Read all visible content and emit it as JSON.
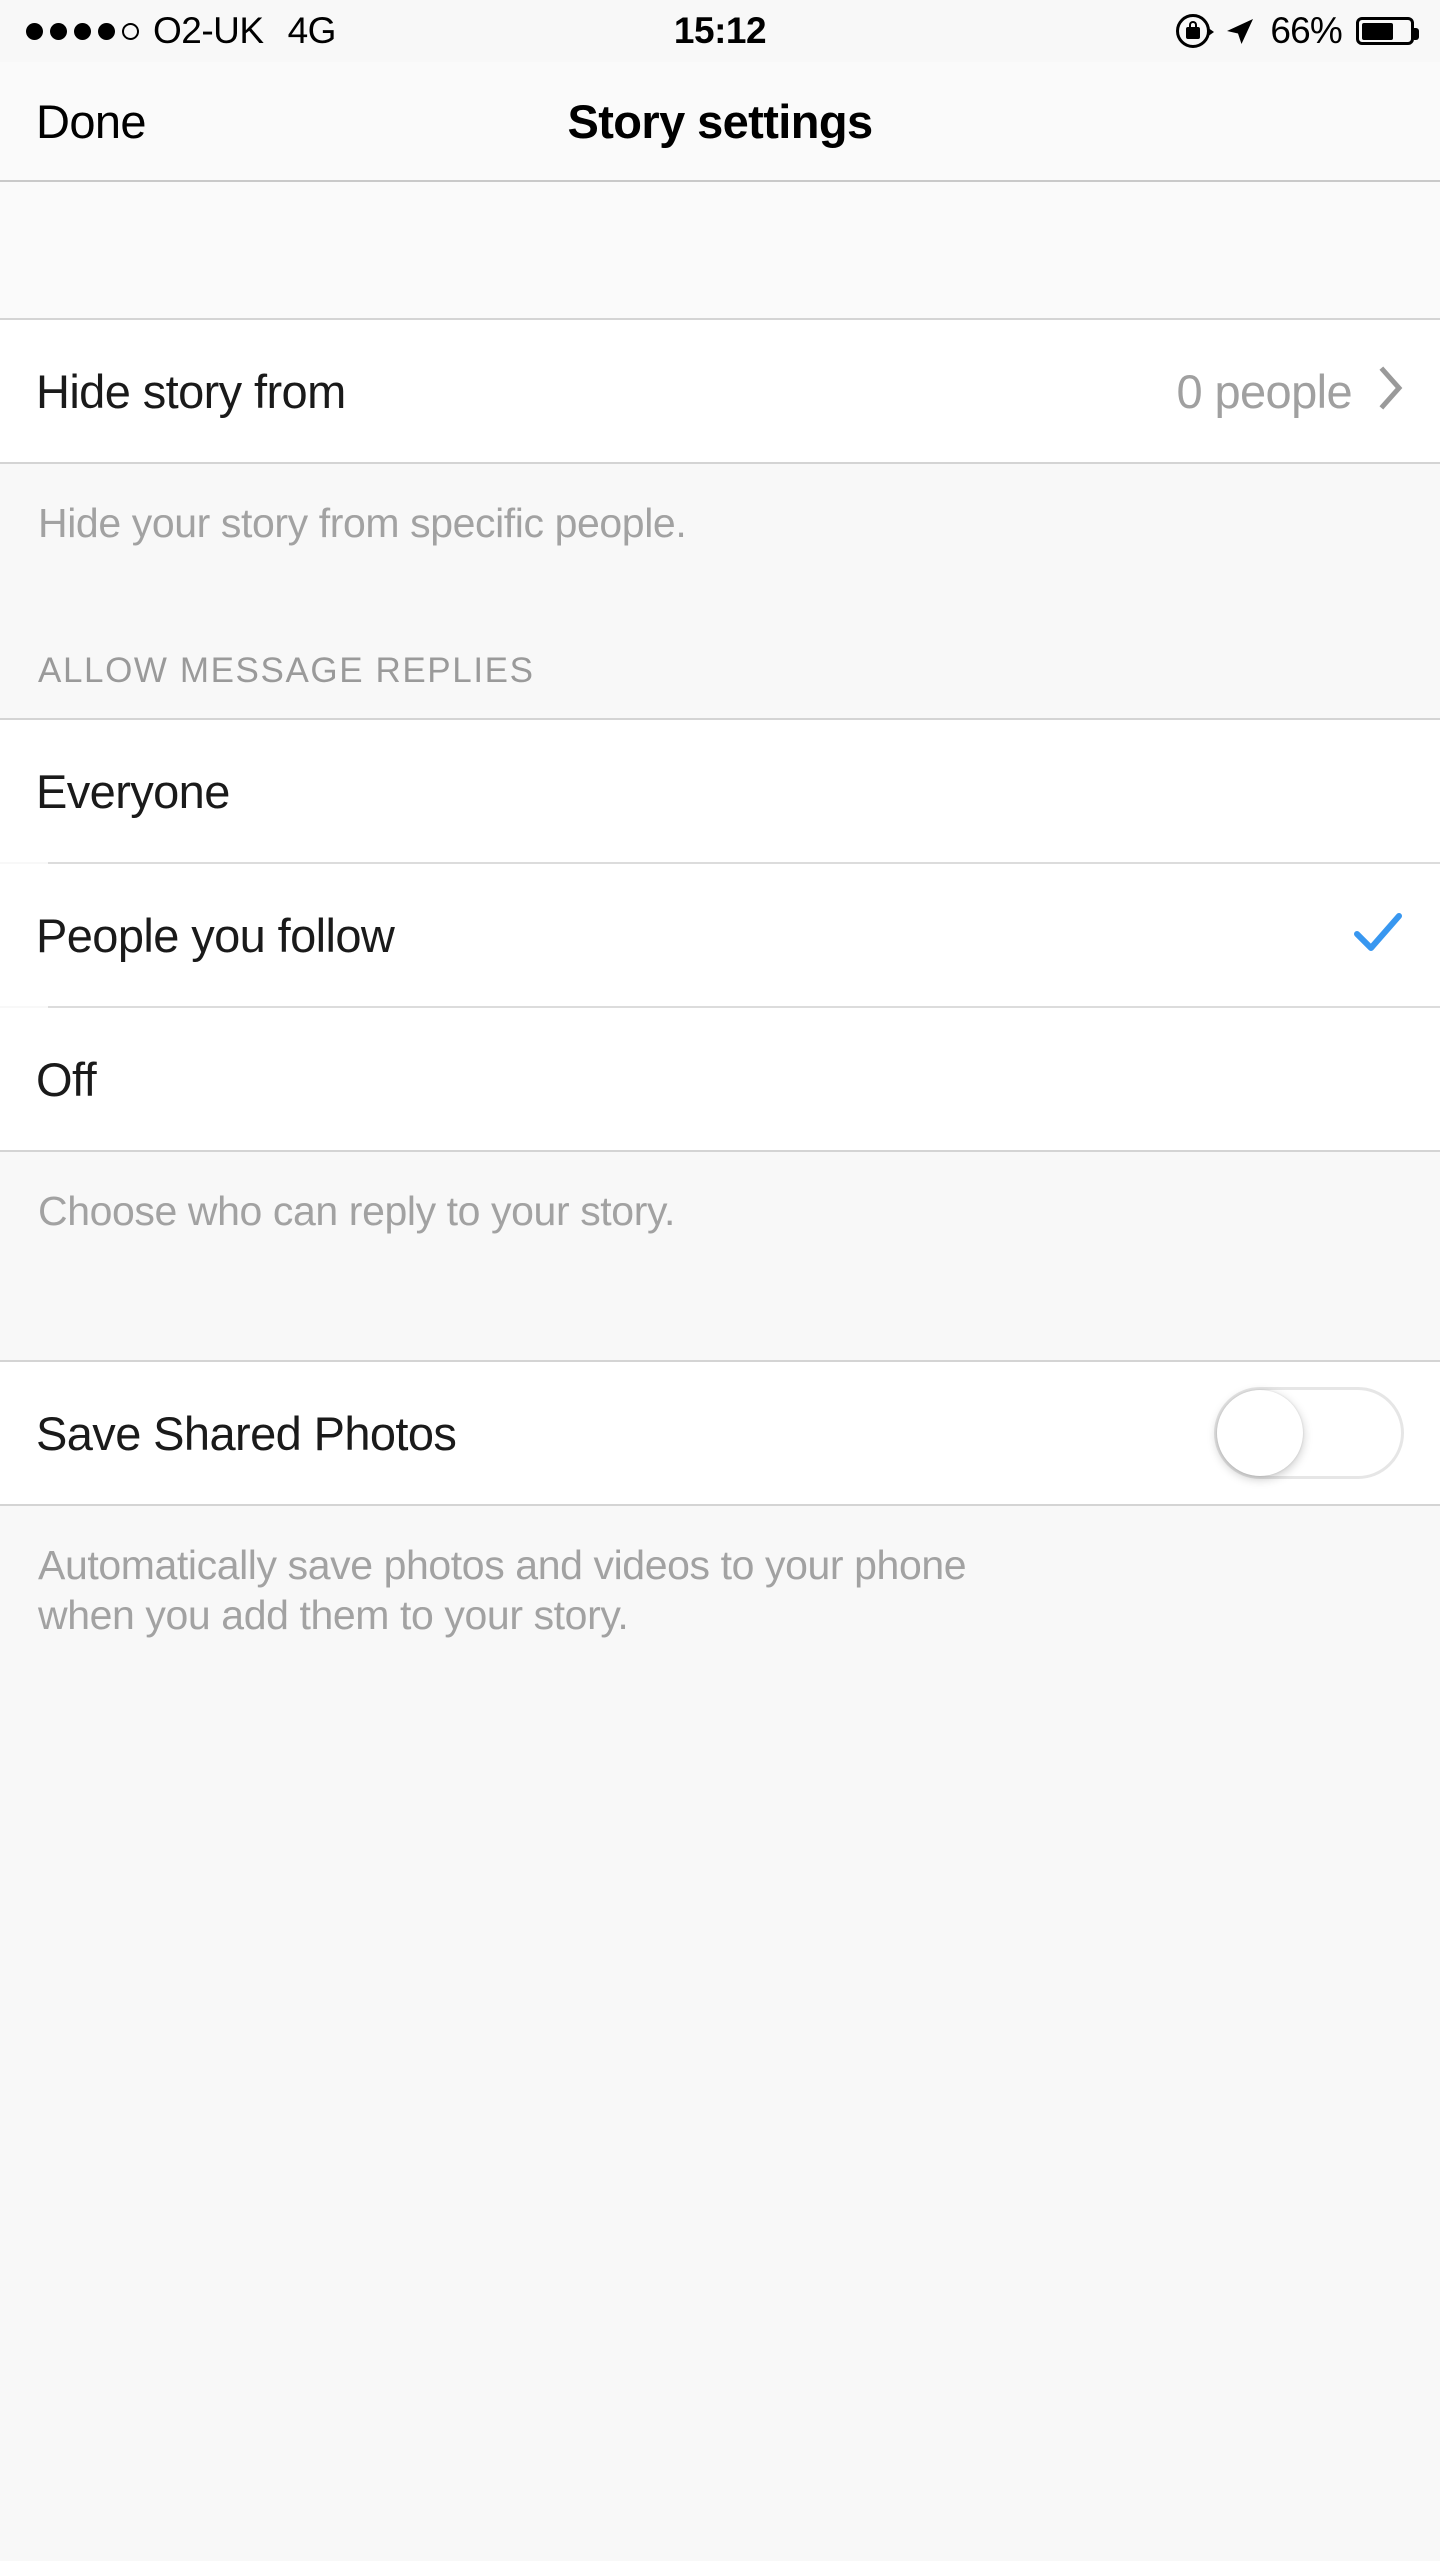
{
  "status_bar": {
    "signal_dots_filled": 4,
    "signal_dots_total": 5,
    "carrier": "O2-UK",
    "network": "4G",
    "time": "15:12",
    "battery_percent": "66%",
    "battery_level": 66,
    "icons": [
      "rotation-lock-icon",
      "location-arrow-icon",
      "battery-icon"
    ]
  },
  "nav_bar": {
    "left_button": "Done",
    "title": "Story settings"
  },
  "sections": {
    "hide_story": {
      "row_label": "Hide story from",
      "row_value": "0 people",
      "disclosure_icon": "chevron-right-icon",
      "footer": "Hide your story from specific people."
    },
    "allow_replies": {
      "header": "ALLOW MESSAGE REPLIES",
      "options": [
        {
          "label": "Everyone",
          "selected": false
        },
        {
          "label": "People you follow",
          "selected": true
        },
        {
          "label": "Off",
          "selected": false
        }
      ],
      "selected_option": "People you follow",
      "check_icon": "checkmark-icon",
      "footer": "Choose who can reply to your story."
    },
    "save_photos": {
      "row_label": "Save Shared Photos",
      "toggle_state": "off",
      "footer_line_1": "Automatically save photos and videos to your phone",
      "footer_line_2": "when you add them to your story."
    }
  },
  "colors": {
    "accent_blue": "#3897f0",
    "page_background": "#f8f8f8",
    "row_background": "#ffffff",
    "separator": "#d4d4d4",
    "secondary_text": "#a0a0a0"
  }
}
